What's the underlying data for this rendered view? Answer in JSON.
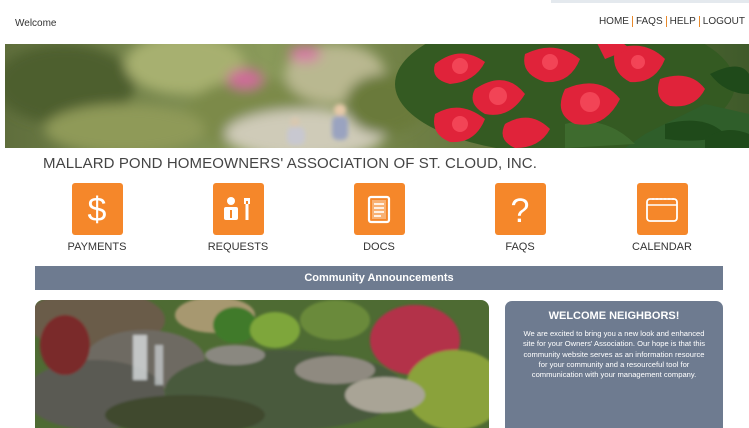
{
  "header": {
    "welcome": "Welcome",
    "nav": [
      {
        "label": "HOME"
      },
      {
        "label": "FAQS"
      },
      {
        "label": "HELP"
      },
      {
        "label": "LOGOUT"
      }
    ]
  },
  "association_title": "MALLARD POND HOMEOWNERS' ASSOCIATION OF ST. CLOUD, INC.",
  "tiles": [
    {
      "label": "PAYMENTS",
      "icon": "dollar-icon"
    },
    {
      "label": "REQUESTS",
      "icon": "tools-icon"
    },
    {
      "label": "DOCS",
      "icon": "document-icon"
    },
    {
      "label": "FAQS",
      "icon": "question-icon"
    },
    {
      "label": "CALENDAR",
      "icon": "calendar-icon"
    }
  ],
  "announcements": {
    "title": "Community Announcements"
  },
  "welcome_card": {
    "title": "WELCOME NEIGHBORS!",
    "body": "We are excited to bring you a new look and enhanced site for your Owners' Association. Our hope is that this community website serves as an information resource for your community and a resourceful tool for communication with your management company."
  },
  "colors": {
    "accent": "#f5872a",
    "slate": "#6e7b90",
    "nav_separator": "#e8892b"
  }
}
